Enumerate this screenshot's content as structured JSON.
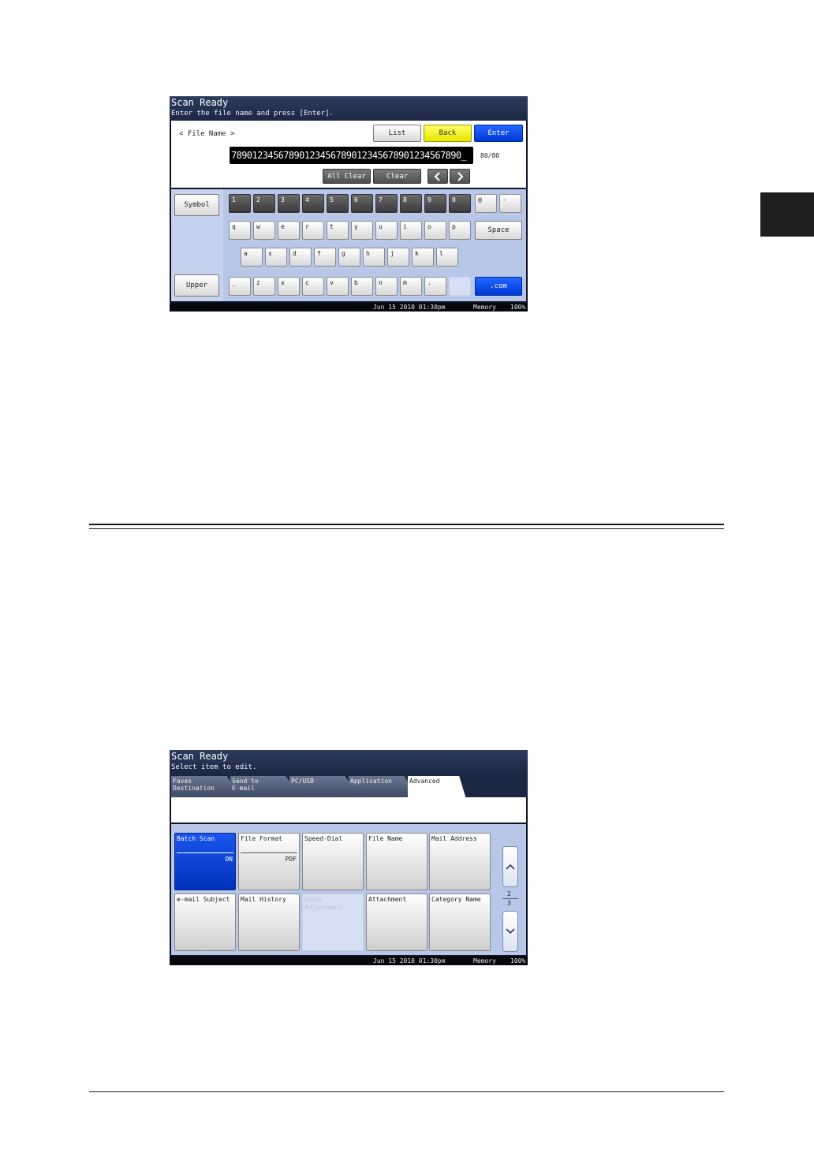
{
  "screen1": {
    "title": "Scan Ready",
    "subtitle": "Enter the file name and press [Enter].",
    "field_label": "< File Name >",
    "buttons": {
      "list": "List",
      "back": "Back",
      "enter": "Enter",
      "all_clear": "All Clear",
      "clear": "Clear"
    },
    "input_value": "78901234567890123456789012345678901234567890_",
    "char_counter": "80/80",
    "side_buttons": {
      "symbol": "Symbol",
      "upper": "Upper"
    },
    "keys": {
      "numbers": [
        "1",
        "2",
        "3",
        "4",
        "5",
        "6",
        "7",
        "8",
        "9",
        "0"
      ],
      "row1_extra": [
        "@",
        "-"
      ],
      "row2": [
        "q",
        "w",
        "e",
        "r",
        "t",
        "y",
        "u",
        "i",
        "o",
        "p"
      ],
      "space": "Space",
      "row3": [
        "a",
        "s",
        "d",
        "f",
        "g",
        "h",
        "j",
        "k",
        "l"
      ],
      "row4": [
        "_",
        "z",
        "x",
        "c",
        "v",
        "b",
        "n",
        "m",
        "."
      ],
      "dotcom": ".com"
    },
    "status": {
      "datetime": "Jun 15 2010 01:30pm",
      "memory_label": "Memory",
      "memory_value": "100%"
    }
  },
  "screen2": {
    "title": "Scan Ready",
    "subtitle": "Select item to edit.",
    "tabs": [
      {
        "line1": "Faves",
        "line2": "Destination"
      },
      {
        "line1": "Send to",
        "line2": "E-mail"
      },
      {
        "line1": "PC/USB",
        "line2": ""
      },
      {
        "line1": "Application",
        "line2": ""
      },
      {
        "line1": "Advanced",
        "line2": ""
      }
    ],
    "tiles": [
      {
        "label": "Batch Scan",
        "label2": "",
        "value": "ON"
      },
      {
        "label": "File Format",
        "label2": "",
        "value": "PDF"
      },
      {
        "label": "Speed-Dial",
        "label2": "",
        "value": ""
      },
      {
        "label": "File Name",
        "label2": "",
        "value": ""
      },
      {
        "label": "Mail Address",
        "label2": "",
        "value": ""
      },
      {
        "label": "e-mail Subject",
        "label2": "",
        "value": ""
      },
      {
        "label": "Mail History",
        "label2": "",
        "value": ""
      },
      {
        "label": "Color",
        "label2": "Adjustment",
        "value": ""
      },
      {
        "label": "Attachment",
        "label2": "",
        "value": ""
      },
      {
        "label": "Category Name",
        "label2": "",
        "value": ""
      }
    ],
    "page": {
      "current": "2",
      "total": "3"
    },
    "scroll_icons": {
      "up": "chevron-up-icon",
      "down": "chevron-down-icon"
    },
    "status": {
      "datetime": "Jun 15 2010 01:30pm",
      "memory_label": "Memory",
      "memory_value": "100%"
    }
  }
}
